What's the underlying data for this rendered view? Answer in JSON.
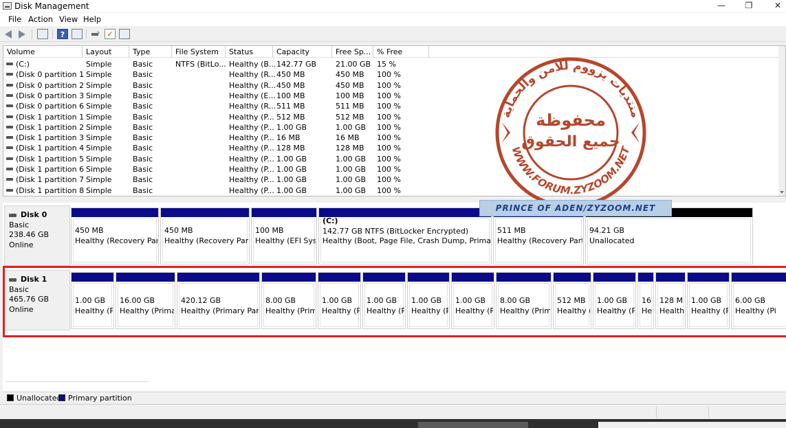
{
  "window": {
    "title": "Disk Management",
    "min": "—",
    "max": "❐",
    "close": "✕"
  },
  "menu": [
    "File",
    "Action",
    "View",
    "Help"
  ],
  "toolbar": {
    "help_label": "?",
    "check_label": "✓"
  },
  "columns": [
    "Volume",
    "Layout",
    "Type",
    "File System",
    "Status",
    "Capacity",
    "Free Sp...",
    "% Free"
  ],
  "volumes": [
    [
      "(C:)",
      "Simple",
      "Basic",
      "NTFS (BitLo...",
      "Healthy (B...",
      "142.77 GB",
      "21.00 GB",
      "15 %"
    ],
    [
      "(Disk 0 partition 1)",
      "Simple",
      "Basic",
      "",
      "Healthy (R...",
      "450 MB",
      "450 MB",
      "100 %"
    ],
    [
      "(Disk 0 partition 2)",
      "Simple",
      "Basic",
      "",
      "Healthy (R...",
      "450 MB",
      "450 MB",
      "100 %"
    ],
    [
      "(Disk 0 partition 3)",
      "Simple",
      "Basic",
      "",
      "Healthy (E...",
      "100 MB",
      "100 MB",
      "100 %"
    ],
    [
      "(Disk 0 partition 6)",
      "Simple",
      "Basic",
      "",
      "Healthy (R...",
      "511 MB",
      "511 MB",
      "100 %"
    ],
    [
      "(Disk 1 partition 1)",
      "Simple",
      "Basic",
      "",
      "Healthy (P...",
      "512 MB",
      "512 MB",
      "100 %"
    ],
    [
      "(Disk 1 partition 2)",
      "Simple",
      "Basic",
      "",
      "Healthy (P...",
      "1.00 GB",
      "1.00 GB",
      "100 %"
    ],
    [
      "(Disk 1 partition 3)",
      "Simple",
      "Basic",
      "",
      "Healthy (P...",
      "16 MB",
      "16 MB",
      "100 %"
    ],
    [
      "(Disk 1 partition 4)",
      "Simple",
      "Basic",
      "",
      "Healthy (P...",
      "128 MB",
      "128 MB",
      "100 %"
    ],
    [
      "(Disk 1 partition 5)",
      "Simple",
      "Basic",
      "",
      "Healthy (P...",
      "1.00 GB",
      "1.00 GB",
      "100 %"
    ],
    [
      "(Disk 1 partition 6)",
      "Simple",
      "Basic",
      "",
      "Healthy (P...",
      "1.00 GB",
      "1.00 GB",
      "100 %"
    ],
    [
      "(Disk 1 partition 7)",
      "Simple",
      "Basic",
      "",
      "Healthy (P...",
      "1.00 GB",
      "1.00 GB",
      "100 %"
    ],
    [
      "(Disk 1 partition 8)",
      "Simple",
      "Basic",
      "",
      "Healthy (P...",
      "1.00 GB",
      "1.00 GB",
      "100 %"
    ]
  ],
  "disks": [
    {
      "name": "Disk 0",
      "type": "Basic",
      "size": "238.46 GB",
      "state": "Online",
      "partitions": [
        {
          "title": "",
          "size": "450 MB",
          "status": "Healthy (Recovery Partiti",
          "kind": "primary"
        },
        {
          "title": "",
          "size": "450 MB",
          "status": "Healthy (Recovery Partiti",
          "kind": "primary"
        },
        {
          "title": "",
          "size": "100 MB",
          "status": "Healthy (EFI Syste",
          "kind": "primary"
        },
        {
          "title": "(C:)",
          "size": "142.77 GB NTFS (BitLocker Encrypted)",
          "status": "Healthy (Boot, Page File, Crash Dump, Primary Par",
          "kind": "primary"
        },
        {
          "title": "",
          "size": "511 MB",
          "status": "Healthy (Recovery Partiti",
          "kind": "primary"
        },
        {
          "title": "",
          "size": "94.21 GB",
          "status": "Unallocated",
          "kind": "unallocated"
        }
      ]
    },
    {
      "name": "Disk 1",
      "type": "Basic",
      "size": "465.76 GB",
      "state": "Online",
      "partitions": [
        {
          "size": "1.00 GB",
          "status": "Healthy (Pi"
        },
        {
          "size": "16.00 GB",
          "status": "Healthy (Primar"
        },
        {
          "size": "420.12 GB",
          "status": "Healthy (Primary Partit"
        },
        {
          "size": "8.00 GB",
          "status": "Healthy (Prima"
        },
        {
          "size": "1.00 GB",
          "status": "Healthy (Pi"
        },
        {
          "size": "1.00 GB",
          "status": "Healthy (Pi"
        },
        {
          "size": "1.00 GB",
          "status": "Healthy (Pi"
        },
        {
          "size": "1.00 GB",
          "status": "Healthy (Pi"
        },
        {
          "size": "8.00 GB",
          "status": "Healthy (Prima"
        },
        {
          "size": "512 MB",
          "status": "Healthy ("
        },
        {
          "size": "1.00 GB",
          "status": "Healthy (Pi"
        },
        {
          "size": "16",
          "status": "He"
        },
        {
          "size": "128 M",
          "status": "Health"
        },
        {
          "size": "1.00 GB",
          "status": "Healthy (Pi"
        },
        {
          "size": "6.00 GB",
          "status": "Healthy (Pi"
        }
      ]
    }
  ],
  "legend": {
    "unallocated": "Unallocated",
    "primary": "Primary partition"
  },
  "colors": {
    "primary": "#0a0a8a",
    "unallocated": "#000000",
    "highlight": "#e02020",
    "watermark": "#b5472c"
  },
  "watermark": {
    "arc_text": "منتديات يزووم للأمن والحماية",
    "center_line1": "محفوظة",
    "center_line2": "جميع الحقوق",
    "url": "WWW.FORUM.ZYZOOM.NET",
    "banner": "PRINCE OF ADEN/ZYZOOM.NET"
  }
}
